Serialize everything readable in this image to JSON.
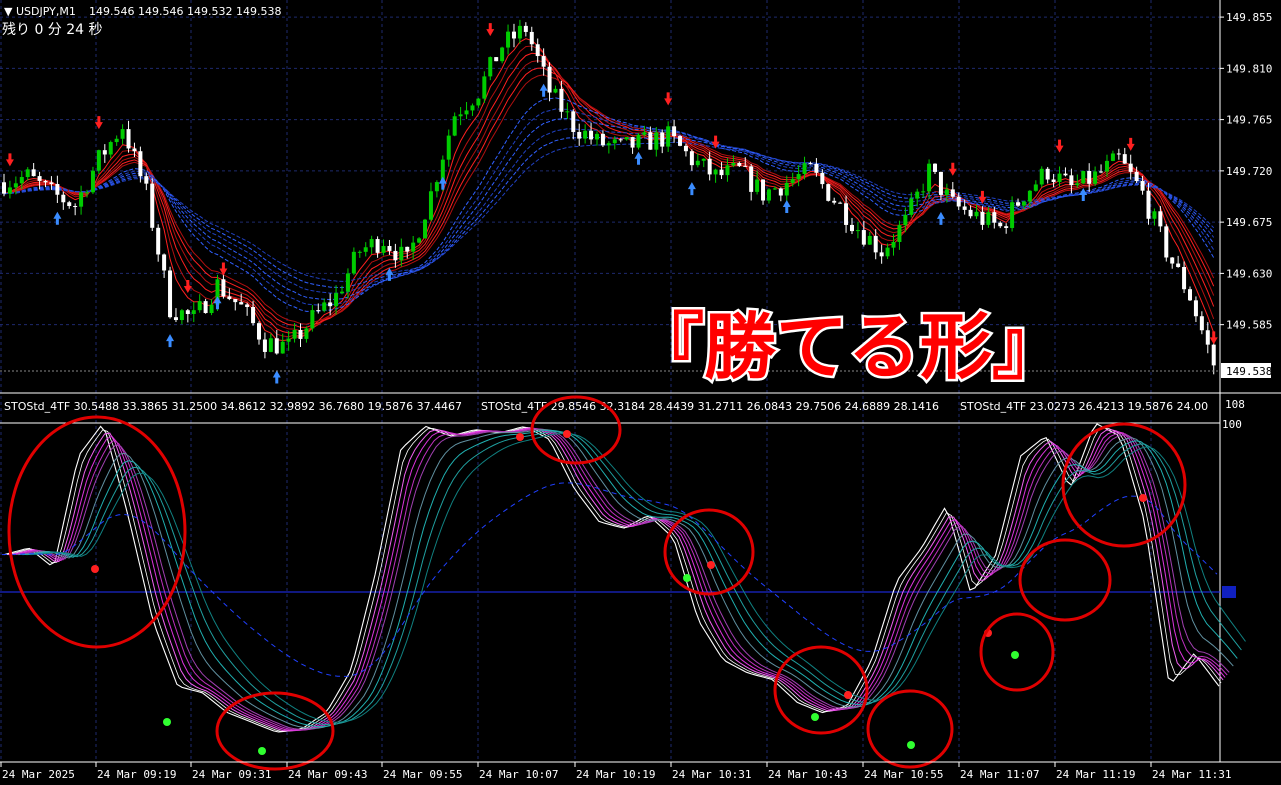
{
  "header": {
    "symbol": "USDJPY,M1",
    "ohlc": "149.546 149.546 149.532 149.538",
    "timer": "残り 0 分 24 秒"
  },
  "indicator_header": {
    "text1": "STOStd_4TF 30.5488 33.3865 31.2500 34.8612 32.9892 36.7680 19.5876 37.4467",
    "text2": "STOStd_4TF 29.8546 32.3184 28.4439 31.2711 26.0843 29.7506 24.6889 28.1416",
    "text3": "STOStd_4TF 23.0273 26.4213 19.5876 24.00",
    "scale_top": "108"
  },
  "overlay_text": "『勝てる形』",
  "colors": {
    "background": "#000000",
    "grid": "#1e2a6e",
    "bull": "#00cc00",
    "bear": "#ffffff",
    "ma_fast": "#ff2020",
    "ma_slow": "#3060ff",
    "stoch_main": "#ffffff",
    "stoch_mid": "#dd33dd",
    "stoch_slow": "#20b0b0",
    "circle": "#e00000",
    "current_price_box": "#ffffff"
  },
  "chart_data": [
    {
      "type": "candlestick",
      "title": "USDJPY,M1",
      "ylabel": "",
      "ylim": [
        149.525,
        149.87
      ],
      "yticks": [
        "149.855",
        "149.810",
        "149.765",
        "149.720",
        "149.675",
        "149.630",
        "149.585"
      ],
      "current_price": "149.538",
      "x": [
        "24 Mar 2025",
        "24 Mar 09:19",
        "24 Mar 09:31",
        "24 Mar 09:43",
        "24 Mar 09:55",
        "24 Mar 10:07",
        "24 Mar 10:19",
        "24 Mar 10:31",
        "24 Mar 10:43",
        "24 Mar 10:55",
        "24 Mar 11:07",
        "24 Mar 11:19",
        "24 Mar 11:31"
      ],
      "close_path": [
        149.71,
        149.715,
        149.7,
        149.69,
        149.73,
        149.76,
        149.7,
        149.6,
        149.59,
        149.62,
        149.6,
        149.57,
        149.565,
        149.59,
        149.61,
        149.65,
        149.66,
        149.64,
        149.7,
        149.77,
        149.79,
        149.83,
        149.845,
        149.79,
        149.76,
        149.745,
        149.74,
        149.745,
        149.75,
        149.73,
        149.715,
        149.72,
        149.7,
        149.71,
        149.72,
        149.695,
        149.67,
        149.65,
        149.675,
        149.72,
        149.69,
        149.68,
        149.67,
        149.7,
        149.72,
        149.705,
        149.715,
        149.73,
        149.7,
        149.65,
        149.61,
        149.55
      ]
    },
    {
      "type": "line",
      "title": "STOStd_4TF",
      "ylim": [
        0,
        108
      ],
      "yticks": [
        "100"
      ],
      "series": [],
      "main_path": [
        60,
        62,
        56,
        90,
        100,
        72,
        40,
        20,
        18,
        12,
        9,
        6,
        7,
        12,
        25,
        55,
        92,
        99,
        96,
        98,
        97,
        99,
        95,
        80,
        70,
        68,
        72,
        65,
        40,
        28,
        24,
        22,
        15,
        12,
        14,
        28,
        52,
        62,
        75,
        48,
        60,
        90,
        96,
        80,
        100,
        96,
        70,
        20,
        30,
        20
      ]
    }
  ]
}
